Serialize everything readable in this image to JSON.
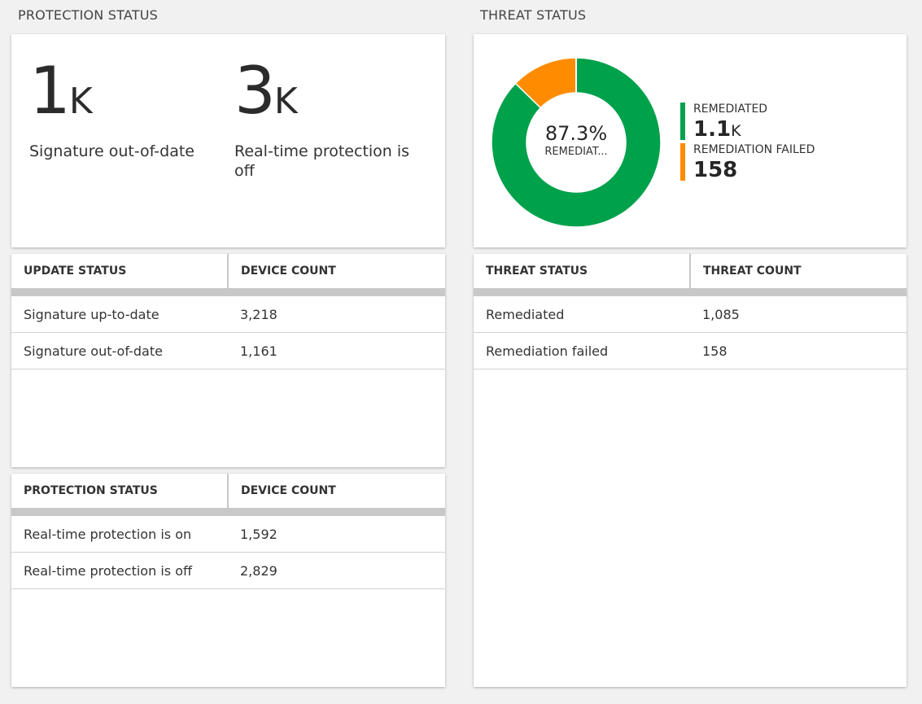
{
  "protection_section": {
    "title": "PROTECTION STATUS",
    "tiles": [
      {
        "value": "1",
        "suffix": "K",
        "label": "Signature out-of-date"
      },
      {
        "value": "3",
        "suffix": "K",
        "label": "Real-time protection is off"
      }
    ]
  },
  "threat_section": {
    "title": "THREAT STATUS",
    "donut": {
      "center_value": "87.3%",
      "center_label": "REMEDIAT...",
      "segments": [
        {
          "label": "REMEDIATED",
          "value": "1.1",
          "suffix": "K",
          "count": 1085,
          "color": "#00a14b"
        },
        {
          "label": "REMEDIATION FAILED",
          "value": "158",
          "suffix": "",
          "count": 158,
          "color": "#ff8c00"
        }
      ]
    }
  },
  "update_table": {
    "columns": [
      "UPDATE STATUS",
      "DEVICE COUNT"
    ],
    "rows": [
      [
        "Signature up-to-date",
        "3,218"
      ],
      [
        "Signature out-of-date",
        "1,161"
      ]
    ]
  },
  "protection_table": {
    "columns": [
      "PROTECTION STATUS",
      "DEVICE COUNT"
    ],
    "rows": [
      [
        "Real-time protection is on",
        "1,592"
      ],
      [
        "Real-time protection is off",
        "2,829"
      ]
    ]
  },
  "threat_table": {
    "columns": [
      "THREAT STATUS",
      "THREAT COUNT"
    ],
    "rows": [
      [
        "Remediated",
        "1,085"
      ],
      [
        "Remediation failed",
        "158"
      ]
    ]
  }
}
